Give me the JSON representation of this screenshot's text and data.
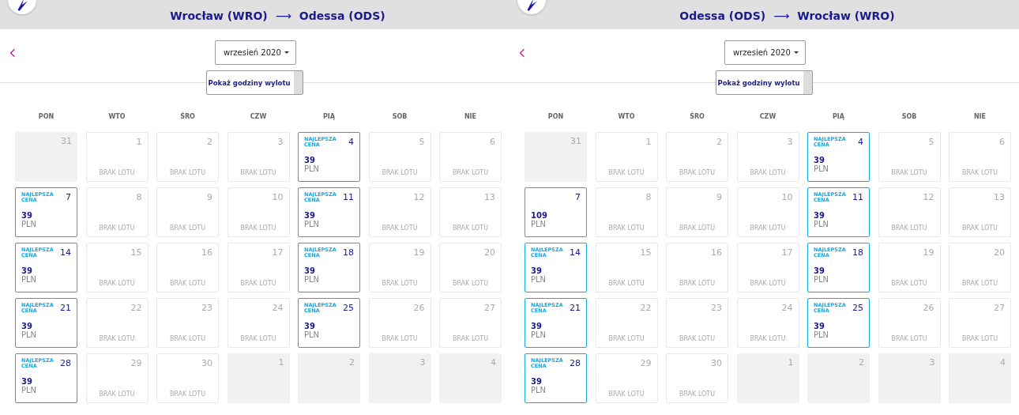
{
  "panels": [
    {
      "route": {
        "from": "Wrocław (WRO)",
        "arrow": "⟶",
        "to": "Odessa (ODS)"
      },
      "month_select": {
        "value": "wrzesień 2020"
      },
      "toggle_button": "Pokaż godziny wylotu",
      "weekdays": [
        "PON",
        "WTO",
        "ŚRO",
        "CZW",
        "PIĄ",
        "SOB",
        "NIE"
      ],
      "days": [
        {
          "day": "31",
          "kind": "outside"
        },
        {
          "day": "1",
          "kind": "none",
          "note": "BRAK LOTU"
        },
        {
          "day": "2",
          "kind": "none",
          "note": "BRAK LOTU"
        },
        {
          "day": "3",
          "kind": "none",
          "note": "BRAK LOTU"
        },
        {
          "day": "4",
          "kind": "flight",
          "best": true,
          "badge": "NAJLEPSZA CENA",
          "price": "39",
          "currency": "PLN"
        },
        {
          "day": "5",
          "kind": "none",
          "note": "BRAK LOTU"
        },
        {
          "day": "6",
          "kind": "none",
          "note": "BRAK LOTU"
        },
        {
          "day": "7",
          "kind": "flight",
          "best": true,
          "badge": "NAJLEPSZA CENA",
          "price": "39",
          "currency": "PLN"
        },
        {
          "day": "8",
          "kind": "none",
          "note": "BRAK LOTU"
        },
        {
          "day": "9",
          "kind": "none",
          "note": "BRAK LOTU"
        },
        {
          "day": "10",
          "kind": "none",
          "note": "BRAK LOTU"
        },
        {
          "day": "11",
          "kind": "flight",
          "best": true,
          "badge": "NAJLEPSZA CENA",
          "price": "39",
          "currency": "PLN"
        },
        {
          "day": "12",
          "kind": "none",
          "note": "BRAK LOTU"
        },
        {
          "day": "13",
          "kind": "none",
          "note": "BRAK LOTU"
        },
        {
          "day": "14",
          "kind": "flight",
          "best": true,
          "badge": "NAJLEPSZA CENA",
          "price": "39",
          "currency": "PLN"
        },
        {
          "day": "15",
          "kind": "none",
          "note": "BRAK LOTU"
        },
        {
          "day": "16",
          "kind": "none",
          "note": "BRAK LOTU"
        },
        {
          "day": "17",
          "kind": "none",
          "note": "BRAK LOTU"
        },
        {
          "day": "18",
          "kind": "flight",
          "best": true,
          "badge": "NAJLEPSZA CENA",
          "price": "39",
          "currency": "PLN"
        },
        {
          "day": "19",
          "kind": "none",
          "note": "BRAK LOTU"
        },
        {
          "day": "20",
          "kind": "none",
          "note": "BRAK LOTU"
        },
        {
          "day": "21",
          "kind": "flight",
          "best": true,
          "badge": "NAJLEPSZA CENA",
          "price": "39",
          "currency": "PLN"
        },
        {
          "day": "22",
          "kind": "none",
          "note": "BRAK LOTU"
        },
        {
          "day": "23",
          "kind": "none",
          "note": "BRAK LOTU"
        },
        {
          "day": "24",
          "kind": "none",
          "note": "BRAK LOTU"
        },
        {
          "day": "25",
          "kind": "flight",
          "best": true,
          "badge": "NAJLEPSZA CENA",
          "price": "39",
          "currency": "PLN"
        },
        {
          "day": "26",
          "kind": "none",
          "note": "BRAK LOTU"
        },
        {
          "day": "27",
          "kind": "none",
          "note": "BRAK LOTU"
        },
        {
          "day": "28",
          "kind": "flight",
          "best": true,
          "badge": "NAJLEPSZA CENA",
          "price": "39",
          "currency": "PLN"
        },
        {
          "day": "29",
          "kind": "none",
          "note": "BRAK LOTU"
        },
        {
          "day": "30",
          "kind": "none",
          "note": "BRAK LOTU"
        },
        {
          "day": "1",
          "kind": "outside"
        },
        {
          "day": "2",
          "kind": "outside"
        },
        {
          "day": "3",
          "kind": "outside"
        },
        {
          "day": "4",
          "kind": "outside"
        }
      ]
    },
    {
      "route": {
        "from": "Odessa (ODS)",
        "arrow": "⟶",
        "to": "Wrocław (WRO)"
      },
      "month_select": {
        "value": "wrzesień 2020"
      },
      "toggle_button": "Pokaż godziny wylotu",
      "weekdays": [
        "PON",
        "WTO",
        "ŚRO",
        "CZW",
        "PIĄ",
        "SOB",
        "NIE"
      ],
      "days": [
        {
          "day": "31",
          "kind": "outside"
        },
        {
          "day": "1",
          "kind": "none",
          "note": "BRAK LOTU"
        },
        {
          "day": "2",
          "kind": "none",
          "note": "BRAK LOTU"
        },
        {
          "day": "3",
          "kind": "none",
          "note": "BRAK LOTU"
        },
        {
          "day": "4",
          "kind": "flight",
          "best": true,
          "badge": "NAJLEPSZA CENA",
          "price": "39",
          "currency": "PLN"
        },
        {
          "day": "5",
          "kind": "none",
          "note": "BRAK LOTU"
        },
        {
          "day": "6",
          "kind": "none",
          "note": "BRAK LOTU"
        },
        {
          "day": "7",
          "kind": "flight",
          "best": false,
          "price": "109",
          "currency": "PLN"
        },
        {
          "day": "8",
          "kind": "none",
          "note": "BRAK LOTU"
        },
        {
          "day": "9",
          "kind": "none",
          "note": "BRAK LOTU"
        },
        {
          "day": "10",
          "kind": "none",
          "note": "BRAK LOTU"
        },
        {
          "day": "11",
          "kind": "flight",
          "best": true,
          "badge": "NAJLEPSZA CENA",
          "price": "39",
          "currency": "PLN"
        },
        {
          "day": "12",
          "kind": "none",
          "note": "BRAK LOTU"
        },
        {
          "day": "13",
          "kind": "none",
          "note": "BRAK LOTU"
        },
        {
          "day": "14",
          "kind": "flight",
          "best": true,
          "badge": "NAJLEPSZA CENA",
          "price": "39",
          "currency": "PLN"
        },
        {
          "day": "15",
          "kind": "none",
          "note": "BRAK LOTU"
        },
        {
          "day": "16",
          "kind": "none",
          "note": "BRAK LOTU"
        },
        {
          "day": "17",
          "kind": "none",
          "note": "BRAK LOTU"
        },
        {
          "day": "18",
          "kind": "flight",
          "best": true,
          "badge": "NAJLEPSZA CENA",
          "price": "39",
          "currency": "PLN"
        },
        {
          "day": "19",
          "kind": "none",
          "note": "BRAK LOTU"
        },
        {
          "day": "20",
          "kind": "none",
          "note": "BRAK LOTU"
        },
        {
          "day": "21",
          "kind": "flight",
          "best": true,
          "badge": "NAJLEPSZA CENA",
          "price": "39",
          "currency": "PLN"
        },
        {
          "day": "22",
          "kind": "none",
          "note": "BRAK LOTU"
        },
        {
          "day": "23",
          "kind": "none",
          "note": "BRAK LOTU"
        },
        {
          "day": "24",
          "kind": "none",
          "note": "BRAK LOTU"
        },
        {
          "day": "25",
          "kind": "flight",
          "best": true,
          "badge": "NAJLEPSZA CENA",
          "price": "39",
          "currency": "PLN"
        },
        {
          "day": "26",
          "kind": "none",
          "note": "BRAK LOTU"
        },
        {
          "day": "27",
          "kind": "none",
          "note": "BRAK LOTU"
        },
        {
          "day": "28",
          "kind": "flight",
          "best": true,
          "badge": "NAJLEPSZA CENA",
          "price": "39",
          "currency": "PLN"
        },
        {
          "day": "29",
          "kind": "none",
          "note": "BRAK LOTU"
        },
        {
          "day": "30",
          "kind": "none",
          "note": "BRAK LOTU"
        },
        {
          "day": "1",
          "kind": "outside"
        },
        {
          "day": "2",
          "kind": "outside"
        },
        {
          "day": "3",
          "kind": "outside"
        },
        {
          "day": "4",
          "kind": "outside"
        }
      ]
    }
  ]
}
